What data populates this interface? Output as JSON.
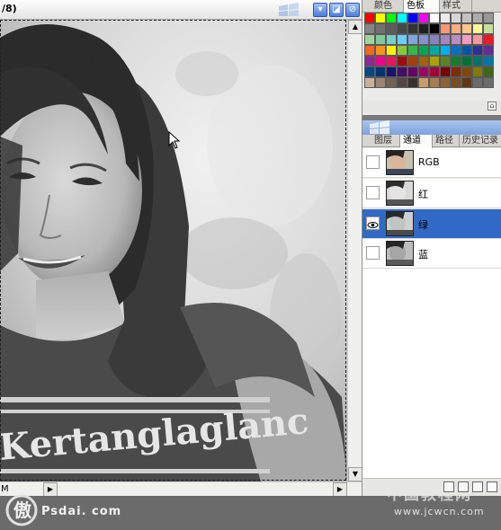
{
  "document": {
    "title_fragment": "/8)",
    "status_text": "M"
  },
  "swatches": {
    "tabs": [
      {
        "label": "颜色",
        "active": false
      },
      {
        "label": "色板",
        "active": true
      },
      {
        "label": "样式",
        "active": false
      }
    ],
    "colors": [
      [
        "#ff0000",
        "#ffff00",
        "#00ff00",
        "#00ffff",
        "#0000ff",
        "#ff00ff",
        "#ffffff",
        "#ebebeb",
        "#d6d6d6",
        "#c2c2c2",
        "#adadad",
        "#999999"
      ],
      [
        "#858585",
        "#707070",
        "#5c5c5c",
        "#474747",
        "#333333",
        "#1f1f1f",
        "#000000",
        "#f7977a",
        "#f9ad81",
        "#fdc68a",
        "#fff79a",
        "#c4df9b"
      ],
      [
        "#a2d39c",
        "#82ca9d",
        "#7bcdc8",
        "#6ecff6",
        "#7ea7d8",
        "#8493ca",
        "#8882be",
        "#a187be",
        "#bc8dbf",
        "#f49ac2",
        "#f6989d",
        "#ed1c24"
      ],
      [
        "#f26522",
        "#f7941d",
        "#fff200",
        "#8dc63f",
        "#39b54a",
        "#00a651",
        "#00a99d",
        "#00aeef",
        "#0072bc",
        "#0054a6",
        "#2e3192",
        "#662d91"
      ],
      [
        "#92278f",
        "#ec008c",
        "#ed145b",
        "#9e0b0f",
        "#a0410d",
        "#a36209",
        "#aba000",
        "#598527",
        "#197b30",
        "#007236",
        "#00746b",
        "#0076a3"
      ],
      [
        "#004a80",
        "#003471",
        "#1b1464",
        "#440e62",
        "#630460",
        "#9e005d",
        "#9e0039",
        "#790000",
        "#7b2e00",
        "#7d4900",
        "#827b00",
        "#406618"
      ],
      [
        "#c7b299",
        "#998675",
        "#736357",
        "#534741",
        "#37302d",
        "#c69c6d",
        "#a67c52",
        "#8c6239",
        "#754c24",
        "#603913",
        "#6b6b6b",
        "#6b6b6b"
      ]
    ]
  },
  "channels": {
    "tabs": [
      {
        "label": "图层",
        "active": false
      },
      {
        "label": "通道",
        "active": true
      },
      {
        "label": "路径",
        "active": false
      },
      {
        "label": "历史记录",
        "active": false
      }
    ],
    "rows": [
      {
        "name": "RGB",
        "visible": false,
        "selected": false
      },
      {
        "name": "红",
        "visible": false,
        "selected": false
      },
      {
        "name": "绿",
        "visible": true,
        "selected": true
      },
      {
        "name": "蓝",
        "visible": false,
        "selected": false
      }
    ]
  },
  "watermarks": {
    "left": "Psdai. com",
    "right_main": "中国教程网",
    "right_url": "www.jcwcn.com"
  },
  "photo_text": "Kertanglaglanc",
  "colors": {
    "selection_blue": "#3169c6",
    "title_gradient": "#7fa2dc"
  }
}
